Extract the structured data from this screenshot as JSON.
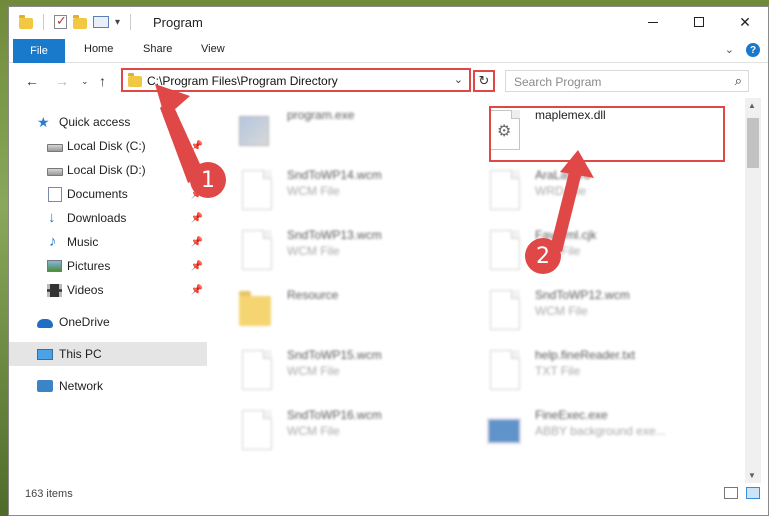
{
  "window": {
    "title": "Program",
    "controls": [
      "minimize",
      "maximize",
      "close"
    ]
  },
  "ribbon": {
    "tabs": [
      {
        "label": "File",
        "active": true
      },
      {
        "label": "Home"
      },
      {
        "label": "Share"
      },
      {
        "label": "View"
      }
    ]
  },
  "navigation": {
    "address": "C:\\Program Files\\Program Directory",
    "search_placeholder": "Search Program"
  },
  "sidebar": {
    "items": [
      {
        "label": "Quick access",
        "icon": "star-icon"
      },
      {
        "label": "Local Disk (C:)",
        "icon": "disk-icon",
        "pinned": true
      },
      {
        "label": "Local Disk (D:)",
        "icon": "disk-icon",
        "pinned": true
      },
      {
        "label": "Documents",
        "icon": "documents-icon",
        "pinned": true
      },
      {
        "label": "Downloads",
        "icon": "download-icon",
        "pinned": true
      },
      {
        "label": "Music",
        "icon": "music-icon",
        "pinned": true
      },
      {
        "label": "Pictures",
        "icon": "pictures-icon",
        "pinned": true
      },
      {
        "label": "Videos",
        "icon": "videos-icon",
        "pinned": true
      },
      {
        "label": "OneDrive",
        "icon": "cloud-icon"
      },
      {
        "label": "This PC",
        "icon": "computer-icon",
        "selected": true
      },
      {
        "label": "Network",
        "icon": "network-icon"
      }
    ]
  },
  "files": [
    {
      "name": "program.exe",
      "type": "",
      "icon": "exe-icon"
    },
    {
      "name": "maplemex.dll",
      "type": "",
      "icon": "dll-icon",
      "highlighted": true
    },
    {
      "name": "SndToWP14.wcm",
      "type": "WCM File",
      "icon": "document-icon"
    },
    {
      "name": "AraLayerd",
      "type": "WRD File",
      "icon": "document-icon"
    },
    {
      "name": "SndToWP13.wcm",
      "type": "WCM File",
      "icon": "document-icon"
    },
    {
      "name": "Favorml.cjk",
      "type": "CJK File",
      "icon": "document-icon"
    },
    {
      "name": "Resource",
      "type": "",
      "icon": "folder-icon"
    },
    {
      "name": "SndToWP12.wcm",
      "type": "WCM File",
      "icon": "document-icon"
    },
    {
      "name": "SndToWP15.wcm",
      "type": "WCM File",
      "icon": "document-icon"
    },
    {
      "name": "help.fineReader.txt",
      "type": "TXT File",
      "icon": "document-icon"
    },
    {
      "name": "SndToWP16.wcm",
      "type": "WCM File",
      "icon": "document-icon"
    },
    {
      "name": "FineExec.exe",
      "type": "ABBY background exe...",
      "icon": "fineexec-icon"
    }
  ],
  "status": {
    "item_count": "163 items"
  },
  "callouts": [
    {
      "label": "1"
    },
    {
      "label": "2"
    }
  ],
  "colors": {
    "accent": "#1979ca",
    "callout": "#e04848"
  }
}
